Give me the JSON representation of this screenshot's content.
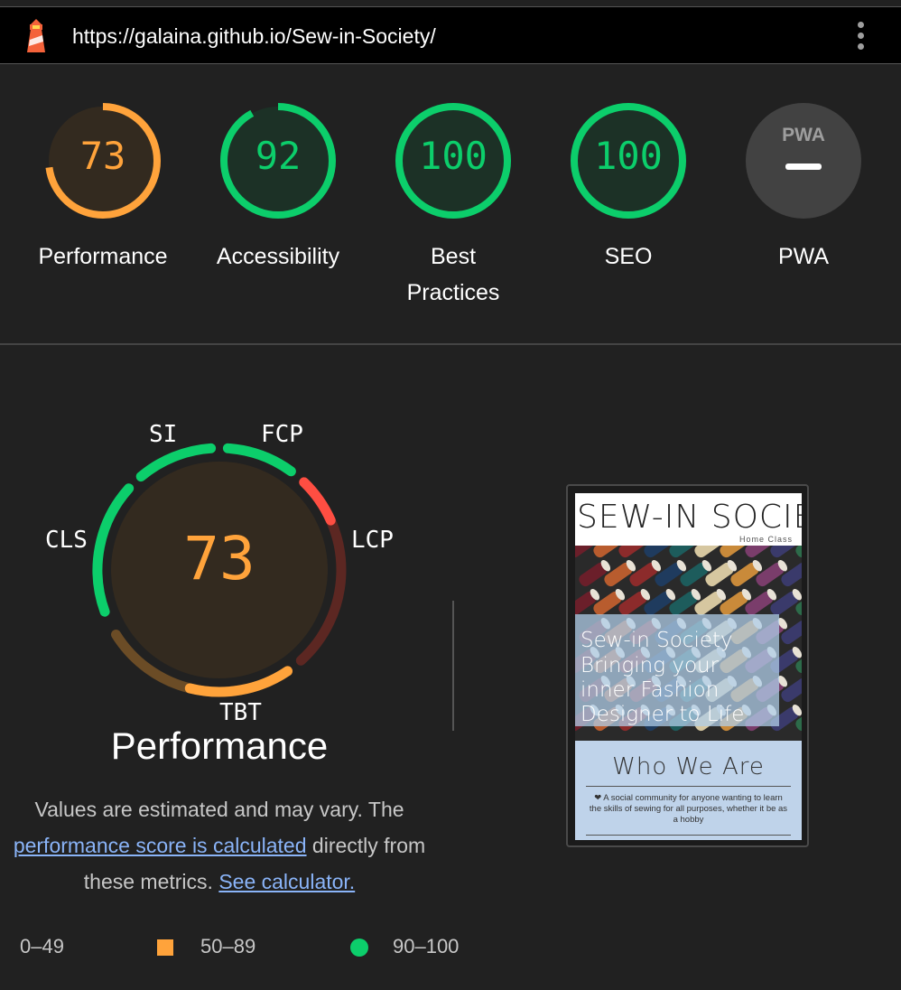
{
  "url_bar": {
    "url": "https://galaina.github.io/Sew-in-Society/",
    "logo_icon": "lighthouse-icon",
    "menu_icon": "more-vert-icon"
  },
  "categories": [
    {
      "label": "Performance",
      "score": "73",
      "value": 73,
      "color": "#ffa33b"
    },
    {
      "label": "Accessibility",
      "score": "92",
      "value": 92,
      "color": "#0cce6b"
    },
    {
      "label_line1": "Best",
      "label_line2": "Practices",
      "score": "100",
      "value": 100,
      "color": "#0cce6b"
    },
    {
      "label": "SEO",
      "score": "100",
      "value": 100,
      "color": "#0cce6b"
    },
    {
      "label": "PWA",
      "badge": "PWA",
      "icon": "pwa-dash-icon"
    }
  ],
  "performance": {
    "score": "73",
    "title": "Performance",
    "metrics": {
      "si": "SI",
      "fcp": "FCP",
      "lcp": "LCP",
      "tbt": "TBT",
      "cls": "CLS"
    },
    "desc_1": "Values are estimated and may vary. The",
    "desc_link": "performance score is calculated",
    "desc_2": "directly from",
    "desc_3": "these metrics.",
    "calc_link": "See calculator."
  },
  "legend": {
    "fail": "0–49",
    "average": "50–89",
    "pass": "90–100"
  },
  "screenshot": {
    "brand": "SEW-IN SOCIETY",
    "nav": "Home   Class",
    "hero_line1": "Sew-in Society",
    "hero_line2": "Bringing your",
    "hero_line3": "inner Fashion",
    "hero_line4": "Designer to Life",
    "section_title": "Who We Are",
    "section_body": "❤ A social community for anyone wanting to learn the skills of sewing for all purposes, whether it be as a hobby"
  },
  "colors": {
    "pass": "#0cce6b",
    "average": "#ffa33b",
    "fail": "#ff4e42",
    "link": "#8ab4f8"
  }
}
